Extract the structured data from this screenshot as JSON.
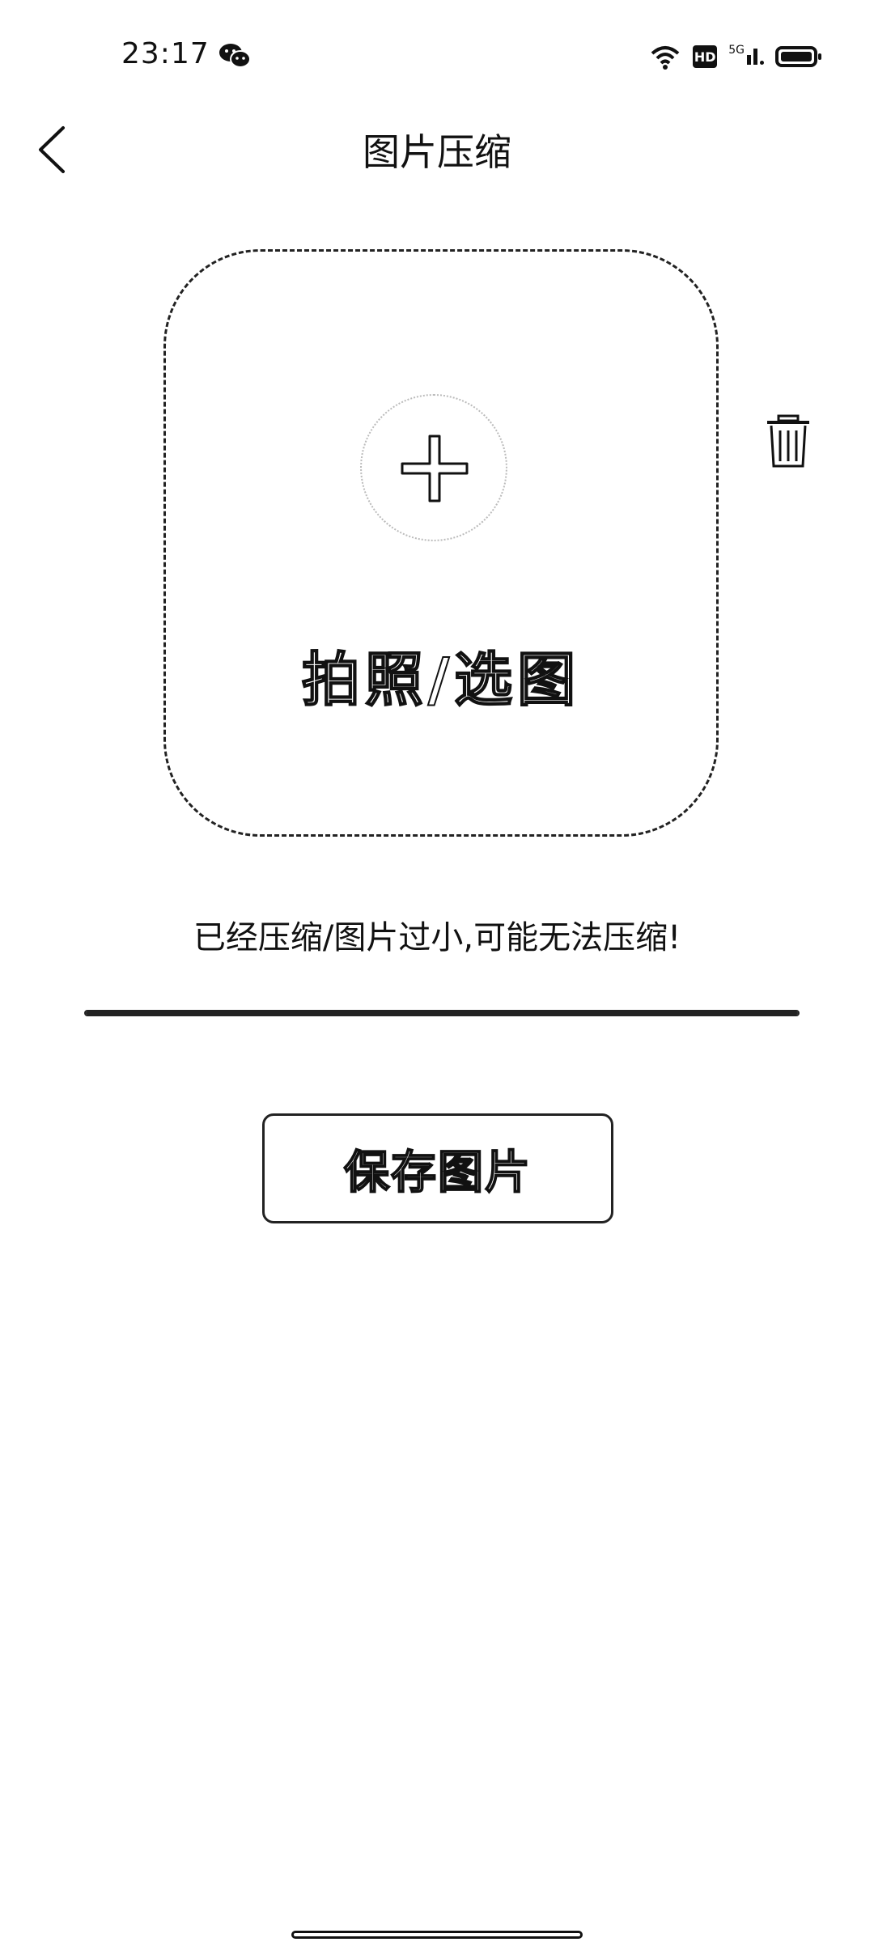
{
  "status_bar": {
    "time": "23:17",
    "network_label": "5G",
    "hd_badge": "HD",
    "icons": [
      "wechat-icon",
      "wifi-icon",
      "hd-icon",
      "signal-5g-icon",
      "battery-icon"
    ]
  },
  "nav": {
    "title": "图片压缩",
    "back_icon": "chevron-left-icon"
  },
  "upload": {
    "label": "拍照/选图",
    "add_icon": "plus-icon",
    "delete_icon": "trash-icon"
  },
  "note": "已经压缩/图片过小,可能无法压缩!",
  "progress": {
    "fraction": 1.0
  },
  "actions": {
    "save_label": "保存图片"
  },
  "colors": {
    "foreground": "#111111",
    "background": "#ffffff"
  }
}
